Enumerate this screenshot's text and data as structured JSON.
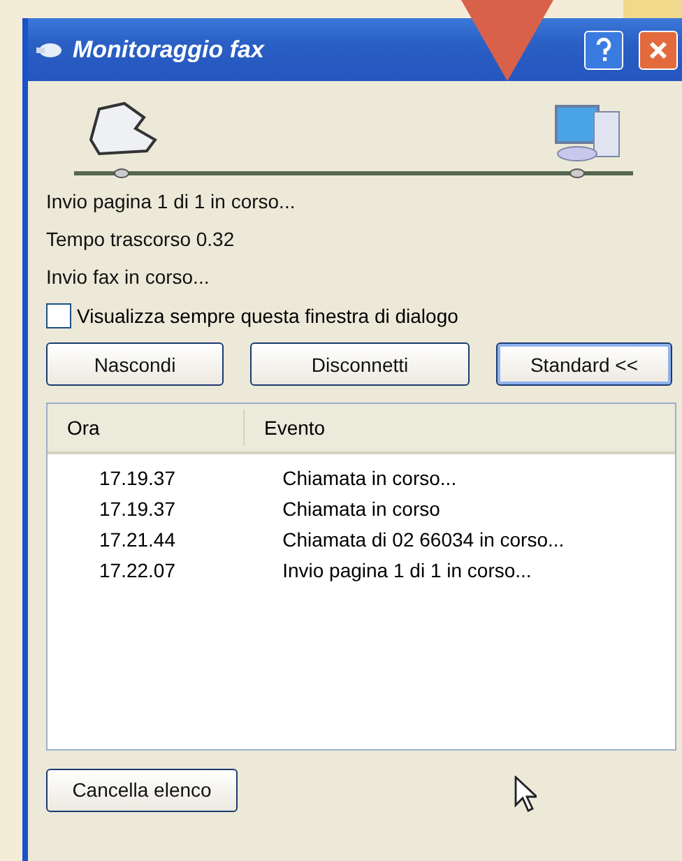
{
  "window": {
    "title": "Monitoraggio fax"
  },
  "status_lines": [
    "Invio pagina 1 di 1 in corso...",
    "Tempo trascorso 0.32",
    "Invio fax  in corso..."
  ],
  "always_show": {
    "label": "Visualizza sempre questa finestra di dialogo",
    "checked": false
  },
  "buttons": [
    {
      "label": "Nascondi",
      "focused": false
    },
    {
      "label": "Disconnetti",
      "focused": false
    },
    {
      "label": "Standard <<",
      "focused": true
    }
  ],
  "log": {
    "columns": [
      "Ora",
      "Evento"
    ],
    "rows": [
      [
        "17.19.37",
        "Chiamata in corso..."
      ],
      [
        "17.19.37",
        "Chiamata in corso"
      ],
      [
        "17.21.44",
        "Chiamata di 02 66034 in corso..."
      ],
      [
        "17.22.07",
        "Invio pagina 1 di 1 in corso..."
      ]
    ]
  },
  "clear_button": {
    "label": "Cancella elenco"
  }
}
